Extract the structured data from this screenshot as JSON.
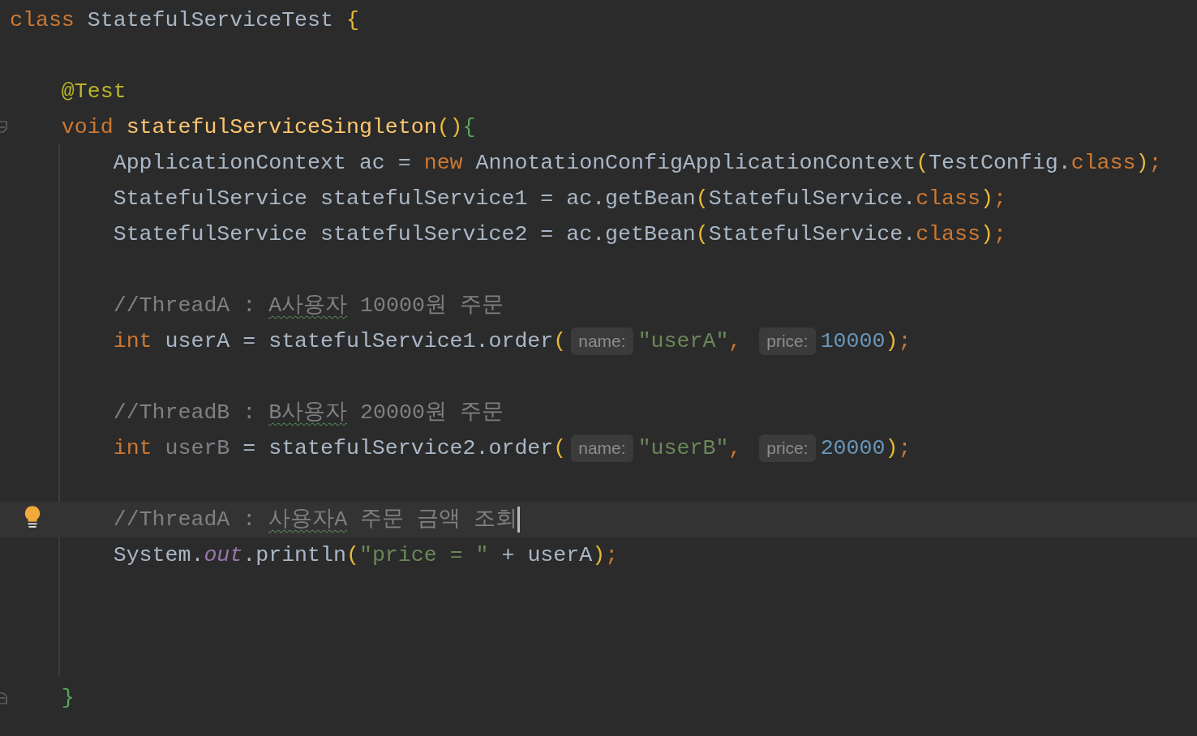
{
  "editor": {
    "lines": [
      {
        "kind": "code",
        "current": false,
        "bulb": false,
        "tokens": [
          {
            "text": "class ",
            "kind": "kw"
          },
          {
            "text": "StatefulServiceTest ",
            "kind": "plain"
          },
          {
            "text": "{",
            "kind": "b1"
          }
        ]
      },
      {
        "kind": "blank",
        "current": false,
        "bulb": false
      },
      {
        "kind": "code",
        "current": false,
        "bulb": false,
        "tokens": [
          {
            "text": "    @Test",
            "kind": "anno"
          }
        ]
      },
      {
        "kind": "code",
        "current": false,
        "bulb": false,
        "fold_start": true,
        "tokens": [
          {
            "text": "    void ",
            "kind": "kw"
          },
          {
            "text": "statefulServiceSingleton",
            "kind": "decl"
          },
          {
            "text": "()",
            "kind": "b1"
          },
          {
            "text": "{",
            "kind": "b2"
          }
        ]
      },
      {
        "kind": "code",
        "current": false,
        "bulb": false,
        "tokens": [
          {
            "text": "        ApplicationContext ac = ",
            "kind": "plain"
          },
          {
            "text": "new ",
            "kind": "kw"
          },
          {
            "text": "AnnotationConfigApplicationContext",
            "kind": "plain"
          },
          {
            "text": "(",
            "kind": "b1"
          },
          {
            "text": "TestConfig.",
            "kind": "plain"
          },
          {
            "text": "class",
            "kind": "kw"
          },
          {
            "text": ")",
            "kind": "b1"
          },
          {
            "text": ";",
            "kind": "kw"
          }
        ]
      },
      {
        "kind": "code",
        "current": false,
        "bulb": false,
        "tokens": [
          {
            "text": "        StatefulService statefulService1 = ac.getBean",
            "kind": "plain"
          },
          {
            "text": "(",
            "kind": "b1"
          },
          {
            "text": "StatefulService.",
            "kind": "plain"
          },
          {
            "text": "class",
            "kind": "kw"
          },
          {
            "text": ")",
            "kind": "b1"
          },
          {
            "text": ";",
            "kind": "kw"
          }
        ]
      },
      {
        "kind": "code",
        "current": false,
        "bulb": false,
        "tokens": [
          {
            "text": "        StatefulService statefulService2 = ac.getBean",
            "kind": "plain"
          },
          {
            "text": "(",
            "kind": "b1"
          },
          {
            "text": "StatefulService.",
            "kind": "plain"
          },
          {
            "text": "class",
            "kind": "kw"
          },
          {
            "text": ")",
            "kind": "b1"
          },
          {
            "text": ";",
            "kind": "kw"
          }
        ]
      },
      {
        "kind": "blank",
        "current": false,
        "bulb": false
      },
      {
        "kind": "code",
        "current": false,
        "bulb": false,
        "tokens": [
          {
            "text": "        //ThreadA : ",
            "kind": "comment"
          },
          {
            "text": "A사용자",
            "kind": "typo"
          },
          {
            "text": " 10000원 주문",
            "kind": "comment"
          }
        ]
      },
      {
        "kind": "code",
        "current": false,
        "bulb": false,
        "tokens": [
          {
            "text": "        int ",
            "kind": "kw"
          },
          {
            "text": "userA = statefulService1.order",
            "kind": "plain"
          },
          {
            "text": "(",
            "kind": "b1"
          },
          {
            "text": "name:",
            "kind": "hint"
          },
          {
            "text": "\"userA\"",
            "kind": "str"
          },
          {
            "text": ", ",
            "kind": "kw"
          },
          {
            "text": "price:",
            "kind": "hint"
          },
          {
            "text": "10000",
            "kind": "num"
          },
          {
            "text": ")",
            "kind": "b1"
          },
          {
            "text": ";",
            "kind": "kw"
          }
        ]
      },
      {
        "kind": "blank",
        "current": false,
        "bulb": false
      },
      {
        "kind": "code",
        "current": false,
        "bulb": false,
        "tokens": [
          {
            "text": "        //ThreadB : ",
            "kind": "comment"
          },
          {
            "text": "B사용자",
            "kind": "typo"
          },
          {
            "text": " 20000원 주문",
            "kind": "comment"
          }
        ]
      },
      {
        "kind": "code",
        "current": false,
        "bulb": false,
        "tokens": [
          {
            "text": "        int ",
            "kind": "kw"
          },
          {
            "text": "userB",
            "kind": "unused"
          },
          {
            "text": " = statefulService2.order",
            "kind": "plain"
          },
          {
            "text": "(",
            "kind": "b1"
          },
          {
            "text": "name:",
            "kind": "hint"
          },
          {
            "text": "\"userB\"",
            "kind": "str"
          },
          {
            "text": ", ",
            "kind": "kw"
          },
          {
            "text": "price:",
            "kind": "hint"
          },
          {
            "text": "20000",
            "kind": "num"
          },
          {
            "text": ")",
            "kind": "b1"
          },
          {
            "text": ";",
            "kind": "kw"
          }
        ]
      },
      {
        "kind": "blank",
        "current": false,
        "bulb": false
      },
      {
        "kind": "code",
        "current": true,
        "bulb": true,
        "tokens": [
          {
            "text": "        //ThreadA : ",
            "kind": "comment"
          },
          {
            "text": "사용자A",
            "kind": "typo"
          },
          {
            "text": " 주문 금액 조회",
            "kind": "comment"
          }
        ]
      },
      {
        "kind": "code",
        "current": false,
        "bulb": false,
        "tokens": [
          {
            "text": "        System.",
            "kind": "plain"
          },
          {
            "text": "out",
            "kind": "field"
          },
          {
            "text": ".println",
            "kind": "plain"
          },
          {
            "text": "(",
            "kind": "b1"
          },
          {
            "text": "\"price = \"",
            "kind": "str"
          },
          {
            "text": " + userA",
            "kind": "plain"
          },
          {
            "text": ")",
            "kind": "b1"
          },
          {
            "text": ";",
            "kind": "kw"
          }
        ]
      },
      {
        "kind": "blank",
        "current": false,
        "bulb": false
      },
      {
        "kind": "blank",
        "current": false,
        "bulb": false
      },
      {
        "kind": "blank",
        "current": false,
        "bulb": false
      },
      {
        "kind": "code",
        "current": false,
        "bulb": false,
        "fold_end": true,
        "tokens": [
          {
            "text": "    }",
            "kind": "b2"
          }
        ]
      }
    ]
  }
}
